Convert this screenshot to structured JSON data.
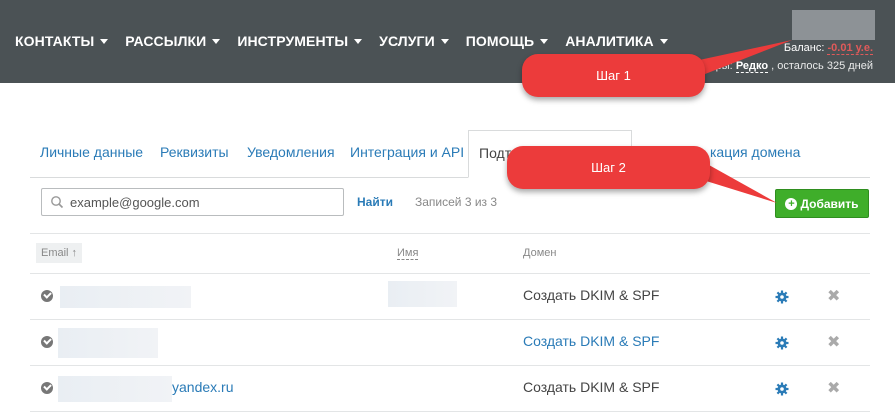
{
  "nav": [
    {
      "label": "КОНТАКТЫ"
    },
    {
      "label": "РАССЫЛКИ"
    },
    {
      "label": "ИНСТРУМЕНТЫ"
    },
    {
      "label": "УСЛУГИ"
    },
    {
      "label": "ПОМОЩЬ"
    },
    {
      "label": "АНАЛИТИКА"
    }
  ],
  "account": {
    "balance_label": "Баланс:",
    "balance_value": "-0.01 у.е.",
    "tariff_prefix": "ры:",
    "tariff_plan": "Редко",
    "tariff_suffix": ", осталось 325 дней"
  },
  "callouts": {
    "step1": "Шаг 1",
    "step2": "Шаг 2"
  },
  "tabs": [
    {
      "label": "Личные данные"
    },
    {
      "label": "Реквизиты"
    },
    {
      "label": "Уведомления"
    },
    {
      "label": "Интеграция и API"
    },
    {
      "label": "Подт"
    },
    {
      "label": "кация домена"
    }
  ],
  "search": {
    "placeholder": "example@google.com"
  },
  "toolbar": {
    "find_label": "Найти",
    "records_label": "Записей 3 из 3",
    "add_label": "Добавить"
  },
  "table": {
    "headers": {
      "email": "Email ↑",
      "name": "Имя",
      "domain": "Домен"
    },
    "rows": [
      {
        "email": "",
        "domain_action": "Создать DKIM & SPF",
        "domain_is_link": false
      },
      {
        "email": "",
        "domain_action": "Создать DKIM & SPF",
        "domain_is_link": true
      },
      {
        "email": "yandex.ru",
        "domain_action": "Создать DKIM & SPF",
        "domain_is_link": false
      }
    ]
  },
  "colors": {
    "topbar": "#4b5255",
    "accent": "#2a7bb7",
    "callout": "#ec3b3b",
    "add": "#3fae2a",
    "negative": "#e05a5a"
  },
  "icons": {
    "search": "search-icon",
    "settings": "gear-icon",
    "delete": "close-icon",
    "status": "check-circle-icon"
  }
}
